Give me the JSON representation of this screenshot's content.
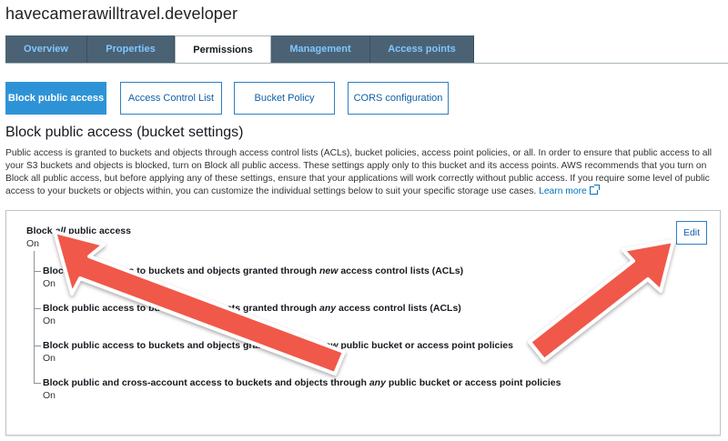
{
  "bucket": {
    "title": "havecamerawilltravel.developer"
  },
  "tabs": [
    {
      "label": "Overview"
    },
    {
      "label": "Properties"
    },
    {
      "label": "Permissions"
    },
    {
      "label": "Management"
    },
    {
      "label": "Access points"
    }
  ],
  "active_tab": "Permissions",
  "subnav": [
    {
      "label": "Block public access"
    },
    {
      "label": "Access Control List"
    },
    {
      "label": "Bucket Policy"
    },
    {
      "label": "CORS configuration"
    }
  ],
  "section": {
    "title": "Block public access (bucket settings)",
    "description": "Public access is granted to buckets and objects through access control lists (ACLs), bucket policies, access point policies, or all. In order to ensure that public access to all your S3 buckets and objects is blocked, turn on Block all public access. These settings apply only to this bucket and its access points. AWS recommends that you turn on Block all public access, but before applying any of these settings, ensure that your applications will work correctly without public access. If you require some level of public access to your buckets or objects within, you can customize the individual settings below to suit your specific storage use cases.",
    "learn_more": "Learn more"
  },
  "panel": {
    "block_all": {
      "prefix": "Block ",
      "emphasis": "all",
      "suffix": " public access",
      "status": "On"
    },
    "edit_label": "Edit",
    "settings": [
      {
        "prefix": "Block public access to buckets and objects granted through ",
        "emphasis": "new",
        "suffix": " access control lists (ACLs)",
        "status": "On"
      },
      {
        "prefix": "Block public access to buckets and objects granted through ",
        "emphasis": "any",
        "suffix": " access control lists (ACLs)",
        "status": "On"
      },
      {
        "prefix": "Block public access to buckets and objects granted through ",
        "emphasis": "new",
        "suffix": " public bucket or access point policies",
        "status": "On"
      },
      {
        "prefix": "Block public and cross-account access to buckets and objects through ",
        "emphasis": "any",
        "suffix": " public bucket or access point policies",
        "status": "On"
      }
    ]
  },
  "colors": {
    "tab_bg": "#4b6274",
    "tab_text": "#7fc7ff",
    "accent": "#2e93d6",
    "annotation_arrow": "#f0584a"
  },
  "icons": {
    "learn_more": "external-link-icon"
  }
}
